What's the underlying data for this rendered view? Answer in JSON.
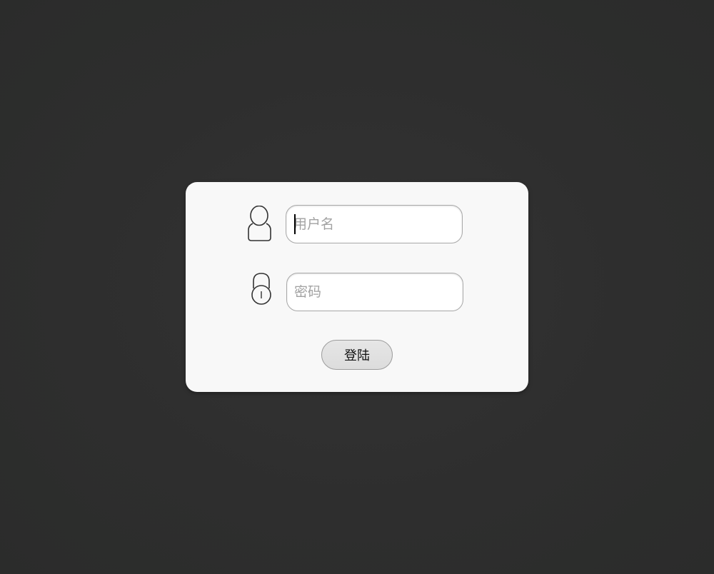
{
  "login": {
    "username": {
      "value": "",
      "placeholder": "用户名"
    },
    "password": {
      "value": "",
      "placeholder": "密码"
    },
    "submit_label": "登陆"
  },
  "icons": {
    "username": "user-icon",
    "password": "lock-icon"
  },
  "colors": {
    "background": "#2e2e2e",
    "card": "#f8f8f8",
    "field_border": "#a8a8a8",
    "button": "#e0e0e0",
    "icon_stroke": "#333333",
    "placeholder": "#a2a2a2"
  }
}
